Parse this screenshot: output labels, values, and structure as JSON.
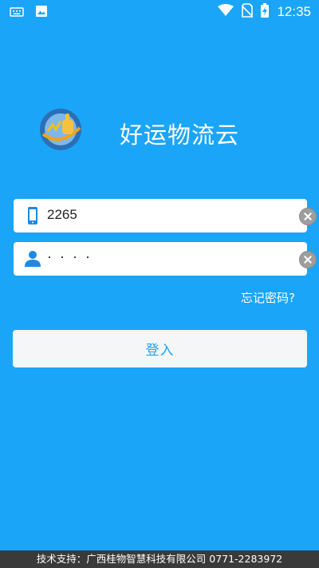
{
  "statusbar": {
    "time": "12:35",
    "icons": [
      "keyboard-icon",
      "image-icon",
      "wifi-icon",
      "no-sim-icon",
      "battery-charging-icon"
    ]
  },
  "app": {
    "title": "好运物流云"
  },
  "form": {
    "phone_value": "2265",
    "password_masked": "····",
    "forgot_label": "忘记密码?",
    "login_label": "登入"
  },
  "footer": {
    "text": "技术支持：广西桂物智慧科技有限公司 0771-2283972"
  },
  "colors": {
    "background": "#1AA5F8",
    "button_text": "#1AA5F8",
    "field_icon": "#1E88E5"
  }
}
